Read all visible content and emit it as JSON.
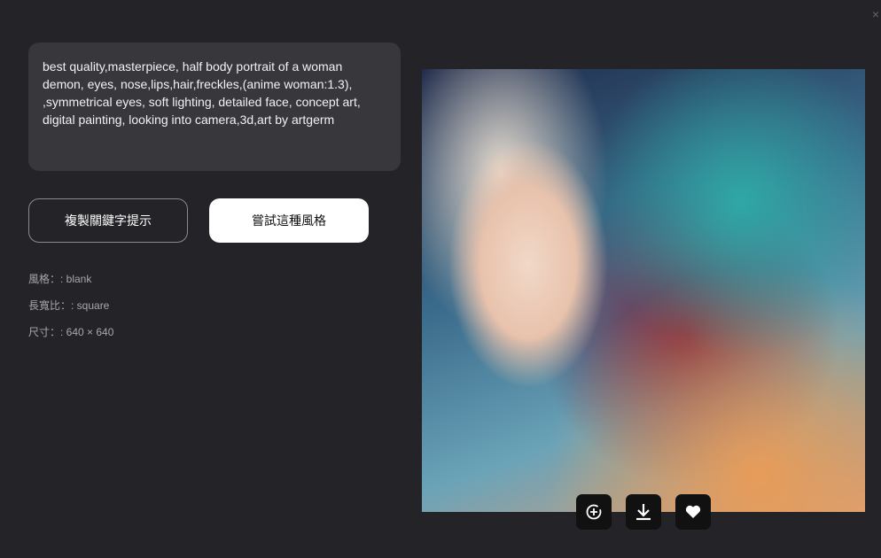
{
  "prompt": "best quality,masterpiece, half body portrait of a woman demon, eyes, nose,lips,hair,freckles,(anime woman:1.3), ,symmetrical eyes, soft lighting, detailed face, concept art, digital painting, looking into camera,3d,art by artgerm",
  "buttons": {
    "copy": "複製關鍵字提示",
    "try": "嘗試這種風格"
  },
  "meta": {
    "style": "風格：: blank",
    "ratio": "長寬比：: square",
    "size": "尺寸：: 640 × 640"
  },
  "actions": [
    "zoom-plus-icon",
    "download-icon",
    "heart-icon"
  ],
  "close": "×"
}
